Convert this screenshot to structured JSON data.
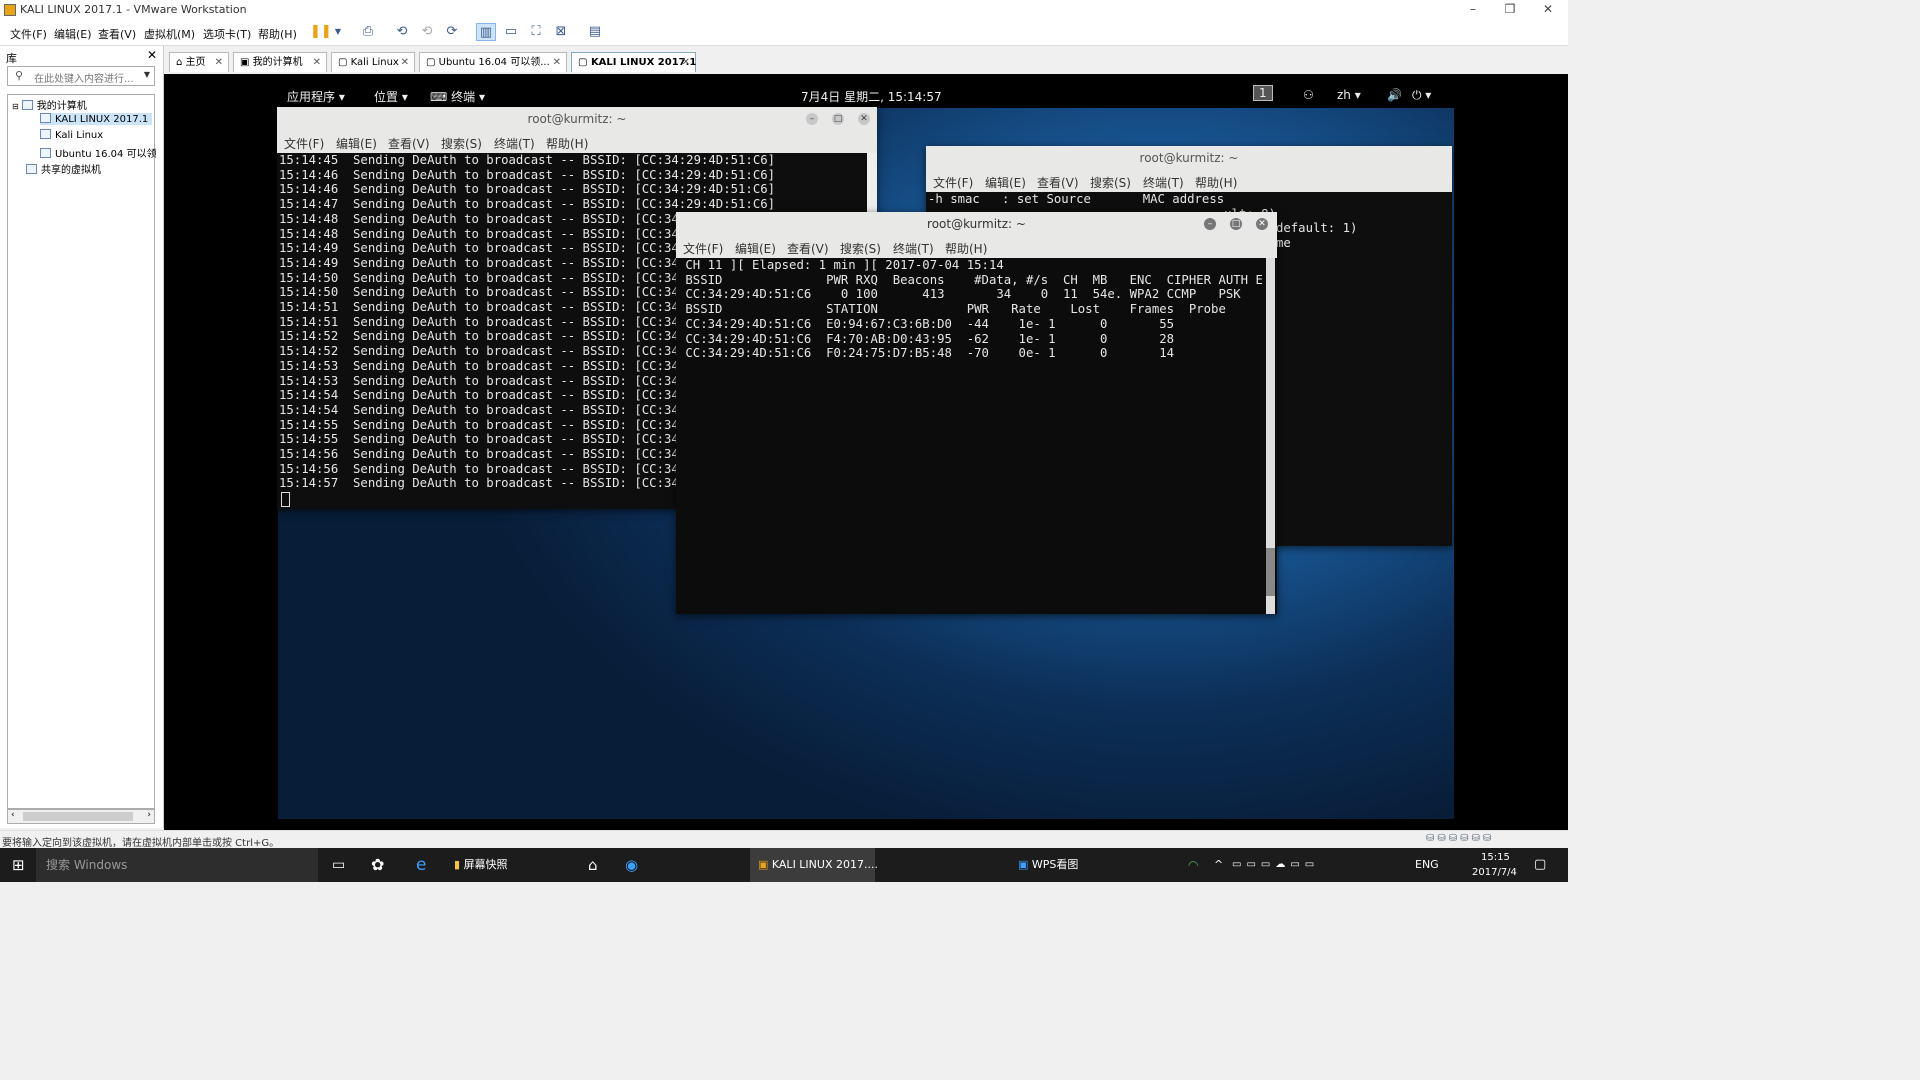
{
  "window": {
    "title": "KALI LINUX 2017.1 - VMware Workstation"
  },
  "menu": [
    "文件(F)",
    "编辑(E)",
    "查看(V)",
    "虚拟机(M)",
    "选项卡(T)",
    "帮助(H)"
  ],
  "library": {
    "header": "库",
    "search_placeholder": "在此处键入内容进行...",
    "tree": [
      "我的计算机",
      "KALI LINUX 2017.1",
      "Kali Linux",
      "Ubuntu 16.04 可以领",
      "共享的虚拟机"
    ]
  },
  "tabs": [
    "主页",
    "我的计算机",
    "Kali Linux",
    "Ubuntu 16.04 可以领...",
    "KALI LINUX 2017.1"
  ],
  "gnome": {
    "apps": "应用程序",
    "places": "位置",
    "terminal": "终端",
    "clock": "7月4日 星期二, 15:14:57",
    "workspace": "1",
    "lang": "zh"
  },
  "term_menu": [
    "文件(F)",
    "编辑(E)",
    "查看(V)",
    "搜索(S)",
    "终端(T)",
    "帮助(H)"
  ],
  "term1": {
    "title": "root@kurmitz: ~",
    "lines": [
      "15:14:45  Sending DeAuth to broadcast -- BSSID: [CC:34:29:4D:51:C6]",
      "15:14:46  Sending DeAuth to broadcast -- BSSID: [CC:34:29:4D:51:C6]",
      "15:14:46  Sending DeAuth to broadcast -- BSSID: [CC:34:29:4D:51:C6]",
      "15:14:47  Sending DeAuth to broadcast -- BSSID: [CC:34:29:4D:51:C6]",
      "15:14:48  Sending DeAuth to broadcast -- BSSID: [CC:34",
      "15:14:48  Sending DeAuth to broadcast -- BSSID: [CC:34",
      "15:14:49  Sending DeAuth to broadcast -- BSSID: [CC:34",
      "15:14:49  Sending DeAuth to broadcast -- BSSID: [CC:34",
      "15:14:50  Sending DeAuth to broadcast -- BSSID: [CC:34",
      "15:14:50  Sending DeAuth to broadcast -- BSSID: [CC:34",
      "15:14:51  Sending DeAuth to broadcast -- BSSID: [CC:34",
      "15:14:51  Sending DeAuth to broadcast -- BSSID: [CC:34",
      "15:14:52  Sending DeAuth to broadcast -- BSSID: [CC:34",
      "15:14:52  Sending DeAuth to broadcast -- BSSID: [CC:34",
      "15:14:53  Sending DeAuth to broadcast -- BSSID: [CC:34",
      "15:14:53  Sending DeAuth to broadcast -- BSSID: [CC:34",
      "15:14:54  Sending DeAuth to broadcast -- BSSID: [CC:34",
      "15:14:54  Sending DeAuth to broadcast -- BSSID: [CC:34",
      "15:14:55  Sending DeAuth to broadcast -- BSSID: [CC:34",
      "15:14:55  Sending DeAuth to broadcast -- BSSID: [CC:34",
      "15:14:56  Sending DeAuth to broadcast -- BSSID: [CC:34",
      "15:14:56  Sending DeAuth to broadcast -- BSSID: [CC:34",
      "15:14:57  Sending DeAuth to broadcast -- BSSID: [CC:34"
    ]
  },
  "term2": {
    "title": "root@kurmitz: ~",
    "lines": [
      "-h smac   : set Source       MAC address",
      "                                        ult: 8)",
      "",
      "",
      "",
      "                                        =auto, default: 1)",
      "",
      "",
      "",
      "",
      "                                      uest n time"
    ]
  },
  "term3": {
    "title": "root@kurmitz: ~",
    "lines": [
      "",
      " CH 11 ][ Elapsed: 1 min ][ 2017-07-04 15:14",
      "",
      " BSSID              PWR RXQ  Beacons    #Data, #/s  CH  MB   ENC  CIPHER AUTH E",
      "",
      " CC:34:29:4D:51:C6    0 100      413       34    0  11  54e. WPA2 CCMP   PSK",
      "",
      " BSSID              STATION            PWR   Rate    Lost    Frames  Probe",
      "",
      " CC:34:29:4D:51:C6  E0:94:67:C3:6B:D0  -44    1e- 1      0       55",
      " CC:34:29:4D:51:C6  F4:70:AB:D0:43:95  -62    1e- 1      0       28",
      " CC:34:29:4D:51:C6  F0:24:75:D7:B5:48  -70    0e- 1      0       14"
    ]
  },
  "statusbar": {
    "message": "要将输入定向到该虚拟机，请在虚拟机内部单击或按 Ctrl+G。"
  },
  "taskbar": {
    "search": "搜索 Windows",
    "items": [
      "屏幕快照",
      "KALI LINUX 2017....",
      "WPS看图"
    ],
    "lang": "ENG",
    "time": "15:15",
    "date": "2017/7/4"
  }
}
